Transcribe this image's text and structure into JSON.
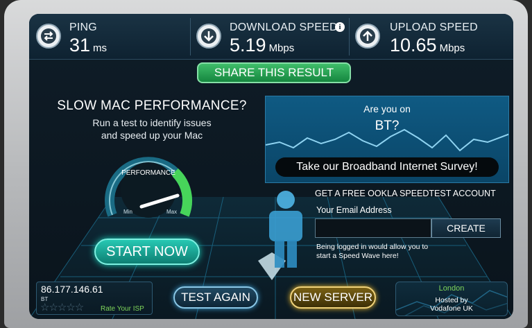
{
  "stats": {
    "ping": {
      "label": "PING",
      "value": "31",
      "unit": "ms",
      "icon": "ping-arrows-icon"
    },
    "download": {
      "label": "DOWNLOAD SPEED",
      "value": "5.19",
      "unit": "Mbps",
      "icon": "download-arrow-icon"
    },
    "upload": {
      "label": "UPLOAD SPEED",
      "value": "10.65",
      "unit": "Mbps",
      "icon": "upload-arrow-icon"
    },
    "info_icon": "i"
  },
  "share_label": "SHARE THIS RESULT",
  "ad_left": {
    "title": "SLOW MAC PERFORMANCE?",
    "subtitle_line1": "Run a test to identify issues",
    "subtitle_line2": "and speed up your Mac",
    "gauge_label": "PERFORMANCE",
    "gauge_min": "Min",
    "gauge_max": "Max",
    "button": "START NOW"
  },
  "survey": {
    "question1": "Are you on",
    "question2": "BT?",
    "button": "Take our Broadband Internet Survey!"
  },
  "account": {
    "title": "GET A FREE OOKLA SPEEDTEST ACCOUNT",
    "email_label": "Your Email Address",
    "email_value": "",
    "create_button": "CREATE",
    "note_line1": "Being logged in would allow you to",
    "note_line2": "start a Speed Wave here!"
  },
  "isp": {
    "ip": "86.177.146.61",
    "name": "BT",
    "stars": "☆☆☆☆☆",
    "rating": 0,
    "rate_label": "Rate Your ISP"
  },
  "buttons": {
    "test_again": "TEST AGAIN",
    "new_server": "NEW SERVER"
  },
  "server": {
    "city": "London",
    "host_line1": "Hosted by",
    "host_line2": "Vodafone UK"
  },
  "colors": {
    "accent_green": "#15863f",
    "accent_teal": "#1ad3bd",
    "accent_gold": "#e9b72c",
    "rating_green": "#7fd65b"
  }
}
